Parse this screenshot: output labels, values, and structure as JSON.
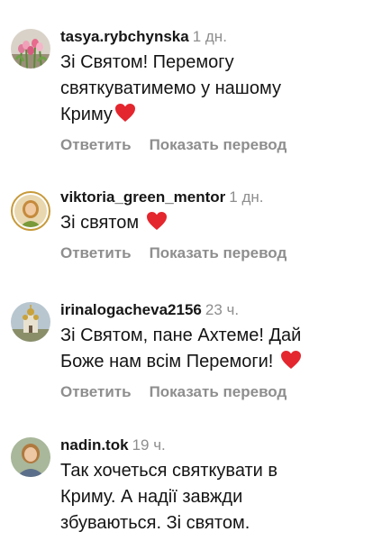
{
  "comments": [
    {
      "username": "tasya.rybchynska",
      "time": "1 дн.",
      "text_lines": [
        "Зі Святом! Перемогу",
        "святкуватимемо у нашому",
        "Криму"
      ],
      "reply_label": "Ответить",
      "translate_label": "Показать перевод",
      "avatar_icon": "tulips-avatar-icon"
    },
    {
      "username": "viktoria_green_mentor",
      "time": "1 дн.",
      "text_lines": [
        "Зі святом "
      ],
      "reply_label": "Ответить",
      "translate_label": "Показать перевод",
      "avatar_icon": "woman-portrait-avatar-icon"
    },
    {
      "username": "irinalogacheva2156",
      "time": "23 ч.",
      "text_lines": [
        "Зі Святом, пане Ахтеме! Дай",
        "Боже нам всім Перемоги! "
      ],
      "reply_label": "Ответить",
      "translate_label": "Показать перевод",
      "avatar_icon": "church-avatar-icon"
    },
    {
      "username": "nadin.tok",
      "time": "19 ч.",
      "text_lines": [
        "Так хочеться святкувати в",
        "Криму. А надії завжди",
        "збуваються. Зі святом."
      ],
      "avatar_icon": "woman-avatar-icon"
    }
  ],
  "colors": {
    "username": "#161616",
    "meta": "#8e8e8e",
    "heart": "#e4262e",
    "story_ring": "#c79a3a"
  }
}
